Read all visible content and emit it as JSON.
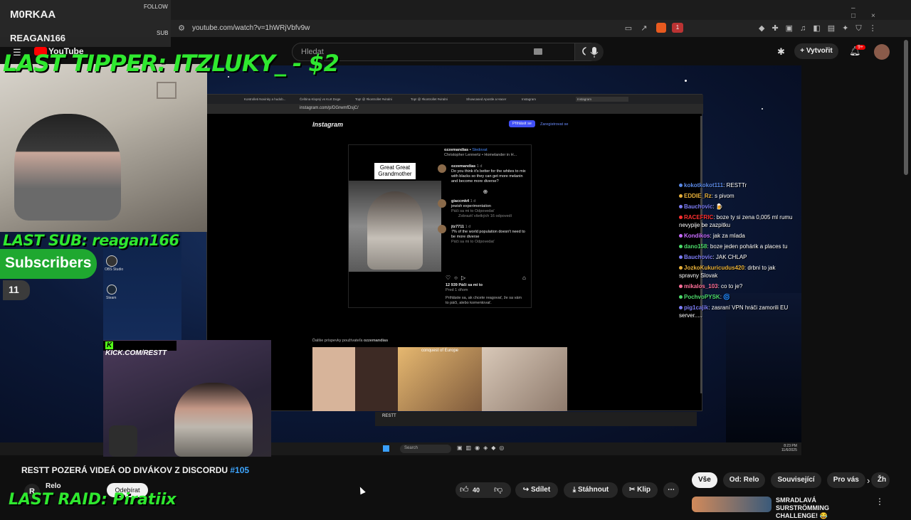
{
  "browser": {
    "url": "youtube.com/watch?v=1hWRjVbfv9w",
    "badge": "1"
  },
  "youtube": {
    "logo": "YouTube",
    "search_placeholder": "Hledat",
    "create_label": "Vytvořit",
    "notif_count": "9+"
  },
  "stream_overlay": {
    "follow_label": "FOLLOW",
    "follower": "M0RKAA",
    "sub_label": "SUB",
    "subscriber": "REAGAN166",
    "last_tipper": "LAST TIPPER: ITZLUKY_ - $2",
    "last_sub": "LAST SUB: reagan166",
    "subscribers_label": "Subscribers",
    "subscribers_count": "11",
    "kick_tag": "KICK.COM/RESTT",
    "last_raid": "LAST RAID: Piratiix",
    "desktop_icons": [
      "OBS Studio",
      "Steam"
    ]
  },
  "instagram_window": {
    "tabs": [
      "Kontrolleti Novinky a hudob...",
      "Čeština Klopný vs Kurt Doge",
      "Top! @ #kontrollet #viralni",
      "Top! @ #kontrollet #viralni",
      "Showcased Apostle a Hacer",
      "Instagram",
      "Instagram"
    ],
    "url": "instagram.com/p/DGrwmfDsjC/",
    "logo": "Instagram",
    "login_button": "Přihlásit se",
    "register_link": "Zaregistrovat se",
    "post": {
      "image_caption": "Great Great Grandmother",
      "author": "ozzemandias",
      "follow": "Sledovat",
      "subtitle": "Christopher Lennertz • Homelander in H...",
      "comments": [
        {
          "user": "ozzemandias",
          "time": "1 d",
          "text": "Do you think it's better for the whites to mix with blacks so they can get more melanin and become more diverse?"
        },
        {
          "user": "giaccmk4",
          "time": "1 d",
          "text": "jewish experimentation",
          "meta": "Páči sa mi to  Odpovedať",
          "replies": "Zobraziť všetkých 16 odpovedí"
        },
        {
          "user": "jtz7711",
          "time": "1 d",
          "text": "7% of the world population doesn't need to be more diverse",
          "meta": "Páči sa mi to  Odpovedať"
        }
      ],
      "likes": "12 939 Páči sa mi to",
      "date": "Pred 1 dňom",
      "login_prompt": "Prihláste sa, ak chcete reagovať, že sa vám to páči, alebo komentovať."
    },
    "more_posts_label": "Ďalšie príspevky používateľa",
    "more_posts_user": "ozzemandias",
    "thumb_caption": "conquest of Europe",
    "dock_user": "RESTT"
  },
  "chat": [
    {
      "user": "kokotkokot111",
      "msg": ": RESTTr",
      "color": "#5b8ae8"
    },
    {
      "user": "EDDIE_Rz",
      "msg": ": s pivom",
      "color": "#e8b13a"
    },
    {
      "user": "Bauchovic",
      "msg": ": 🍺",
      "color": "#7d7df5"
    },
    {
      "user": "RACEFRIC",
      "msg": ": boze ty si zena 0,005 ml rumu nevypije be zazpitku",
      "color": "#ff3030"
    },
    {
      "user": "Kondikos",
      "msg": ": jak za mlada",
      "color": "#c86bff"
    },
    {
      "user": "dano158",
      "msg": ": boze jeden pohárik a places tu",
      "color": "#4ddc6b"
    },
    {
      "user": "Bauchovic",
      "msg": ": JAK CHLAP",
      "color": "#7d7df5"
    },
    {
      "user": "JozkoKukuricudus420",
      "msg": ": drbni to jak spravny Slovak",
      "color": "#e8b13a"
    },
    {
      "user": "mikalos_103",
      "msg": ": co to je?",
      "color": "#ff6f9a"
    },
    {
      "user": "PochvoPYSK",
      "msg": ": 🌀",
      "color": "#4ddc6b"
    },
    {
      "user": "pig1cajik",
      "msg": ": zasraní VPN hráči zamorili EU server.....",
      "color": "#7d7df5"
    }
  ],
  "taskbar": {
    "search": "Search",
    "time": "8:23 PM",
    "date": "11/6/2025"
  },
  "video_info": {
    "title": "RESTT POZERÁ VIDEÁ OD DIVÁKOV Z DISCORDU",
    "hashtag": "#105",
    "channel": "Relo",
    "subscribe": "Odebírat",
    "likes": "40",
    "share": "Sdílet",
    "download": "Stáhnout",
    "clip": "Klip"
  },
  "chips": [
    "Vše",
    "Od: Relo",
    "Související",
    "Pro vás",
    "Žh"
  ],
  "recommendation": {
    "title": "SMRADLAVÁ SURSTRÖMMING CHALLENGE! 😂"
  }
}
